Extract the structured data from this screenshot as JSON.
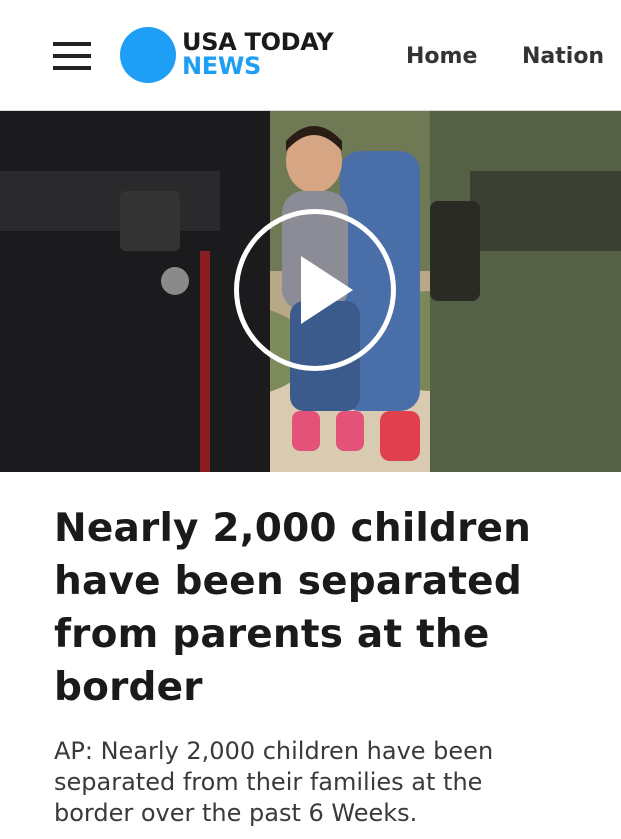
{
  "header": {
    "menu_icon": "hamburger-menu-icon",
    "logo": {
      "line1": "USA TODAY",
      "line2": "NEWS",
      "brand_color": "#1e9ef4"
    },
    "nav": [
      {
        "label": "Home"
      },
      {
        "label": "Nation"
      }
    ]
  },
  "hero": {
    "play_icon": "play-icon",
    "overlay_color": "#ffffff"
  },
  "article": {
    "headline": "Nearly 2,000 children have been separated from parents at the border",
    "summary": "AP: Nearly 2,000 children have been separated from their families at the border over the past 6 Weeks."
  }
}
